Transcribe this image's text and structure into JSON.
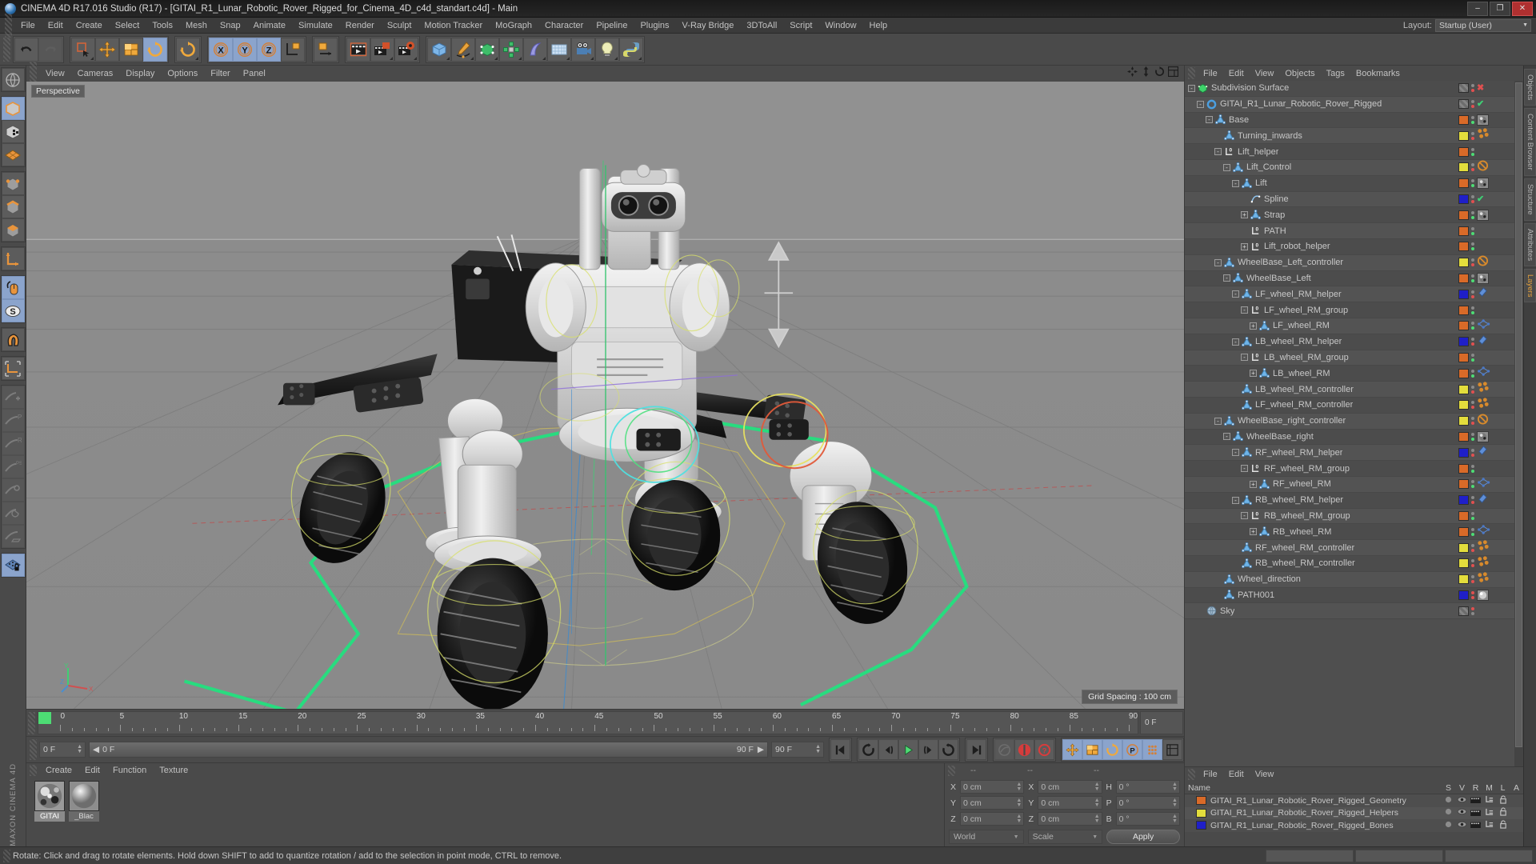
{
  "window": {
    "title": "CINEMA 4D R17.016 Studio (R17) - [GITAI_R1_Lunar_Robotic_Rover_Rigged_for_Cinema_4D_c4d_standart.c4d] - Main",
    "minimize": "–",
    "maximize": "❐",
    "close": "✕"
  },
  "menu": {
    "items": [
      "File",
      "Edit",
      "Create",
      "Select",
      "Tools",
      "Mesh",
      "Snap",
      "Animate",
      "Simulate",
      "Render",
      "Sculpt",
      "Motion Tracker",
      "MoGraph",
      "Character",
      "Pipeline",
      "Plugins",
      "V-Ray Bridge",
      "3DToAll",
      "Script",
      "Window",
      "Help"
    ],
    "layout_label": "Layout:",
    "layout_value": "Startup (User)"
  },
  "viewport": {
    "menu": [
      "View",
      "Cameras",
      "Display",
      "Options",
      "Filter",
      "Panel"
    ],
    "perspective_label": "Perspective",
    "grid_spacing": "Grid Spacing : 100 cm",
    "axis_x": "X",
    "axis_y": "Y",
    "axis_z": "Z"
  },
  "timeline": {
    "ticks": [
      0,
      5,
      10,
      15,
      20,
      25,
      30,
      35,
      40,
      45,
      50,
      55,
      60,
      65,
      70,
      75,
      80,
      85,
      90
    ],
    "current_frame": "0 F",
    "end_frame_box": "0 F",
    "start_field": "0 F",
    "preview_field": "0 F",
    "range_end": "90 F",
    "end_field": "90 F"
  },
  "transport": {
    "buttons": [
      "go-to-start",
      "rewind",
      "step-back",
      "play",
      "step-forward",
      "loop",
      "go-to-end",
      "record-auto",
      "record-keyframe",
      "keyframe-help"
    ]
  },
  "tools_top": {
    "undo": "undo",
    "redo": "redo",
    "select": "live-selection",
    "move": "move",
    "scale": "scale",
    "rotate": "rotate",
    "rotate2": "rotate-alt",
    "x": "X",
    "y": "Y",
    "z": "Z",
    "world": "world-coordinate",
    "object_axis": "object-axis",
    "render_view": "render-view",
    "render_region": "render-region",
    "render_settings": "render-settings",
    "cube": "primitive-cube",
    "spline": "spline-pen",
    "generator": "generator",
    "mograph": "mograph-cloner",
    "deformer": "deformer",
    "environment": "environment-floor",
    "camera": "camera",
    "light": "light",
    "python": "python"
  },
  "materials": {
    "menu": [
      "Create",
      "Edit",
      "Function",
      "Texture"
    ],
    "items": [
      {
        "name": "GITAI",
        "selected": true
      },
      {
        "name": "_Blac",
        "selected": false
      }
    ]
  },
  "coordinates": {
    "header": [
      "--",
      "--",
      "--"
    ],
    "rows": [
      {
        "pos_label": "X",
        "pos": "0 cm",
        "size_label": "X",
        "size": "0 cm",
        "rot_label": "H",
        "rot": "0 °"
      },
      {
        "pos_label": "Y",
        "pos": "0 cm",
        "size_label": "Y",
        "size": "0 cm",
        "rot_label": "P",
        "rot": "0 °"
      },
      {
        "pos_label": "Z",
        "pos": "0 cm",
        "size_label": "Z",
        "size": "0 cm",
        "rot_label": "B",
        "rot": "0 °"
      }
    ],
    "system": "World",
    "mode": "Scale",
    "apply": "Apply"
  },
  "object_manager": {
    "menu": [
      "File",
      "Edit",
      "View",
      "Objects",
      "Tags",
      "Bookmarks"
    ],
    "rows": [
      {
        "label": "Subdivision Surface",
        "depth": 0,
        "expander": "-",
        "icon": "subdivision-surface",
        "layer": "none",
        "dot_top": "#8a8a8a",
        "dot_bot": "#e05050",
        "tag": "x-red"
      },
      {
        "label": "GITAI_R1_Lunar_Robotic_Rover_Rigged",
        "depth": 1,
        "expander": "-",
        "icon": "null-circle",
        "layer": "none",
        "dot_top": "#8a8a8a",
        "dot_bot": "#e05050",
        "tag": "check-green"
      },
      {
        "label": "Base",
        "depth": 2,
        "expander": "-",
        "icon": "joint",
        "layer": "#d96a28",
        "dot_top": "#8a8a8a",
        "dot_bot": "#4ddc74",
        "tag": "sphere"
      },
      {
        "label": "Turning_inwards",
        "depth": 3,
        "expander": "none",
        "icon": "joint",
        "layer": "#e3dd3c",
        "dot_top": "#8a8a8a",
        "dot_bot": "#e05050",
        "tag": "beads"
      },
      {
        "label": "Lift_helper",
        "depth": 3,
        "expander": "-",
        "icon": "null-L0",
        "layer": "#d96a28",
        "dot_top": "#8a8a8a",
        "dot_bot": "#4ddc74",
        "tag": "none"
      },
      {
        "label": "Lift_Control",
        "depth": 4,
        "expander": "-",
        "icon": "joint",
        "layer": "#e3dd3c",
        "dot_top": "#8a8a8a",
        "dot_bot": "#e05050",
        "tag": "ban"
      },
      {
        "label": "Lift",
        "depth": 5,
        "expander": "-",
        "icon": "joint",
        "layer": "#d96a28",
        "dot_top": "#8a8a8a",
        "dot_bot": "#4ddc74",
        "tag": "sphere"
      },
      {
        "label": "Spline",
        "depth": 6,
        "expander": "none",
        "icon": "spline",
        "layer": "#1f1fc8",
        "dot_top": "#8a8a8a",
        "dot_bot": "#e05050",
        "tag": "check-green"
      },
      {
        "label": "Strap",
        "depth": 6,
        "expander": "+",
        "icon": "joint",
        "layer": "#d96a28",
        "dot_top": "#8a8a8a",
        "dot_bot": "#4ddc74",
        "tag": "sphere"
      },
      {
        "label": "PATH",
        "depth": 6,
        "expander": "none",
        "icon": "null-L0",
        "layer": "#d96a28",
        "dot_top": "#8a8a8a",
        "dot_bot": "#4ddc74",
        "tag": "none"
      },
      {
        "label": "Lift_robot_helper",
        "depth": 6,
        "expander": "+",
        "icon": "null-L0",
        "layer": "#d96a28",
        "dot_top": "#8a8a8a",
        "dot_bot": "#4ddc74",
        "tag": "none"
      },
      {
        "label": "WheelBase_Left_controller",
        "depth": 3,
        "expander": "-",
        "icon": "joint",
        "layer": "#e3dd3c",
        "dot_top": "#8a8a8a",
        "dot_bot": "#e05050",
        "tag": "ban"
      },
      {
        "label": "WheelBase_Left",
        "depth": 4,
        "expander": "-",
        "icon": "joint",
        "layer": "#d96a28",
        "dot_top": "#8a8a8a",
        "dot_bot": "#4ddc74",
        "tag": "sphere"
      },
      {
        "label": "LF_wheel_RM_helper",
        "depth": 5,
        "expander": "-",
        "icon": "joint",
        "layer": "#1f1fc8",
        "dot_top": "#8a8a8a",
        "dot_bot": "#e05050",
        "tag": "blue-tag"
      },
      {
        "label": "LF_wheel_RM_group",
        "depth": 6,
        "expander": "-",
        "icon": "null-L0",
        "layer": "#d96a28",
        "dot_top": "#8a8a8a",
        "dot_bot": "#4ddc74",
        "tag": "none"
      },
      {
        "label": "LF_wheel_RM",
        "depth": 7,
        "expander": "+",
        "icon": "joint",
        "layer": "#d96a28",
        "dot_top": "#8a8a8a",
        "dot_bot": "#4ddc74",
        "tag": "xpresso"
      },
      {
        "label": "LB_wheel_RM_helper",
        "depth": 5,
        "expander": "-",
        "icon": "joint",
        "layer": "#1f1fc8",
        "dot_top": "#8a8a8a",
        "dot_bot": "#e05050",
        "tag": "blue-tag"
      },
      {
        "label": "LB_wheel_RM_group",
        "depth": 6,
        "expander": "-",
        "icon": "null-L0",
        "layer": "#d96a28",
        "dot_top": "#8a8a8a",
        "dot_bot": "#4ddc74",
        "tag": "none"
      },
      {
        "label": "LB_wheel_RM",
        "depth": 7,
        "expander": "+",
        "icon": "joint",
        "layer": "#d96a28",
        "dot_top": "#8a8a8a",
        "dot_bot": "#4ddc74",
        "tag": "xpresso"
      },
      {
        "label": "LB_wheel_RM_controller",
        "depth": 5,
        "expander": "none",
        "icon": "joint",
        "layer": "#e3dd3c",
        "dot_top": "#8a8a8a",
        "dot_bot": "#e05050",
        "tag": "beads"
      },
      {
        "label": "LF_wheel_RM_controller",
        "depth": 5,
        "expander": "none",
        "icon": "joint",
        "layer": "#e3dd3c",
        "dot_top": "#8a8a8a",
        "dot_bot": "#e05050",
        "tag": "beads"
      },
      {
        "label": "WheelBase_right_controller",
        "depth": 3,
        "expander": "-",
        "icon": "joint",
        "layer": "#e3dd3c",
        "dot_top": "#8a8a8a",
        "dot_bot": "#e05050",
        "tag": "ban"
      },
      {
        "label": "WheelBase_right",
        "depth": 4,
        "expander": "-",
        "icon": "joint",
        "layer": "#d96a28",
        "dot_top": "#8a8a8a",
        "dot_bot": "#4ddc74",
        "tag": "sphere"
      },
      {
        "label": "RF_wheel_RM_helper",
        "depth": 5,
        "expander": "-",
        "icon": "joint",
        "layer": "#1f1fc8",
        "dot_top": "#8a8a8a",
        "dot_bot": "#e05050",
        "tag": "blue-tag"
      },
      {
        "label": "RF_wheel_RM_group",
        "depth": 6,
        "expander": "-",
        "icon": "null-L0",
        "layer": "#d96a28",
        "dot_top": "#8a8a8a",
        "dot_bot": "#4ddc74",
        "tag": "none"
      },
      {
        "label": "RF_wheel_RM",
        "depth": 7,
        "expander": "+",
        "icon": "joint",
        "layer": "#d96a28",
        "dot_top": "#8a8a8a",
        "dot_bot": "#4ddc74",
        "tag": "xpresso"
      },
      {
        "label": "RB_wheel_RM_helper",
        "depth": 5,
        "expander": "-",
        "icon": "joint",
        "layer": "#1f1fc8",
        "dot_top": "#8a8a8a",
        "dot_bot": "#e05050",
        "tag": "blue-tag"
      },
      {
        "label": "RB_wheel_RM_group",
        "depth": 6,
        "expander": "-",
        "icon": "null-L0",
        "layer": "#d96a28",
        "dot_top": "#8a8a8a",
        "dot_bot": "#4ddc74",
        "tag": "none"
      },
      {
        "label": "RB_wheel_RM",
        "depth": 7,
        "expander": "+",
        "icon": "joint",
        "layer": "#d96a28",
        "dot_top": "#8a8a8a",
        "dot_bot": "#4ddc74",
        "tag": "xpresso"
      },
      {
        "label": "RF_wheel_RM_controller",
        "depth": 5,
        "expander": "none",
        "icon": "joint",
        "layer": "#e3dd3c",
        "dot_top": "#8a8a8a",
        "dot_bot": "#e05050",
        "tag": "beads"
      },
      {
        "label": "RB_wheel_RM_controller",
        "depth": 5,
        "expander": "none",
        "icon": "joint",
        "layer": "#e3dd3c",
        "dot_top": "#8a8a8a",
        "dot_bot": "#e05050",
        "tag": "beads"
      },
      {
        "label": "Wheel_direction",
        "depth": 3,
        "expander": "none",
        "icon": "joint",
        "layer": "#e3dd3c",
        "dot_top": "#8a8a8a",
        "dot_bot": "#e05050",
        "tag": "beads"
      },
      {
        "label": "PATH001",
        "depth": 3,
        "expander": "none",
        "icon": "joint",
        "layer": "#1f1fc8",
        "dot_top": "#e05050",
        "dot_bot": "#e05050",
        "tag": "sphere-grey"
      },
      {
        "label": "Sky",
        "depth": 1,
        "expander": "none",
        "icon": "sky",
        "layer": "none",
        "dot_top": "#e05050",
        "dot_bot": "#8a8a8a",
        "tag": "none"
      }
    ]
  },
  "layer_manager": {
    "menu": [
      "File",
      "Edit",
      "View"
    ],
    "columns": [
      "Name",
      "S",
      "V",
      "R",
      "M",
      "L",
      "A"
    ],
    "rows": [
      {
        "name": "GITAI_R1_Lunar_Robotic_Rover_Rigged_Geometry",
        "color": "#d96a28"
      },
      {
        "name": "GITAI_R1_Lunar_Robotic_Rover_Rigged_Helpers",
        "color": "#e3dd3c"
      },
      {
        "name": "GITAI_R1_Lunar_Robotic_Rover_Rigged_Bones",
        "color": "#1f1fc8"
      }
    ]
  },
  "edge_tabs": [
    "Objects",
    "Content Browser",
    "Structure",
    "Attributes",
    "Layers"
  ],
  "status": {
    "message": "Rotate: Click and drag to rotate elements. Hold down SHIFT to add to quantize rotation / add to the selection in point mode, CTRL to remove."
  },
  "branding": "MAXON CINEMA 4D",
  "colors": {
    "accent_orange": "#d96a28",
    "accent_yellow": "#e3dd3c",
    "accent_blue": "#1f1fc8",
    "highlight_blue": "#8ba4cc",
    "green_play": "#4ddc74",
    "red_record": "#d83c3c"
  }
}
